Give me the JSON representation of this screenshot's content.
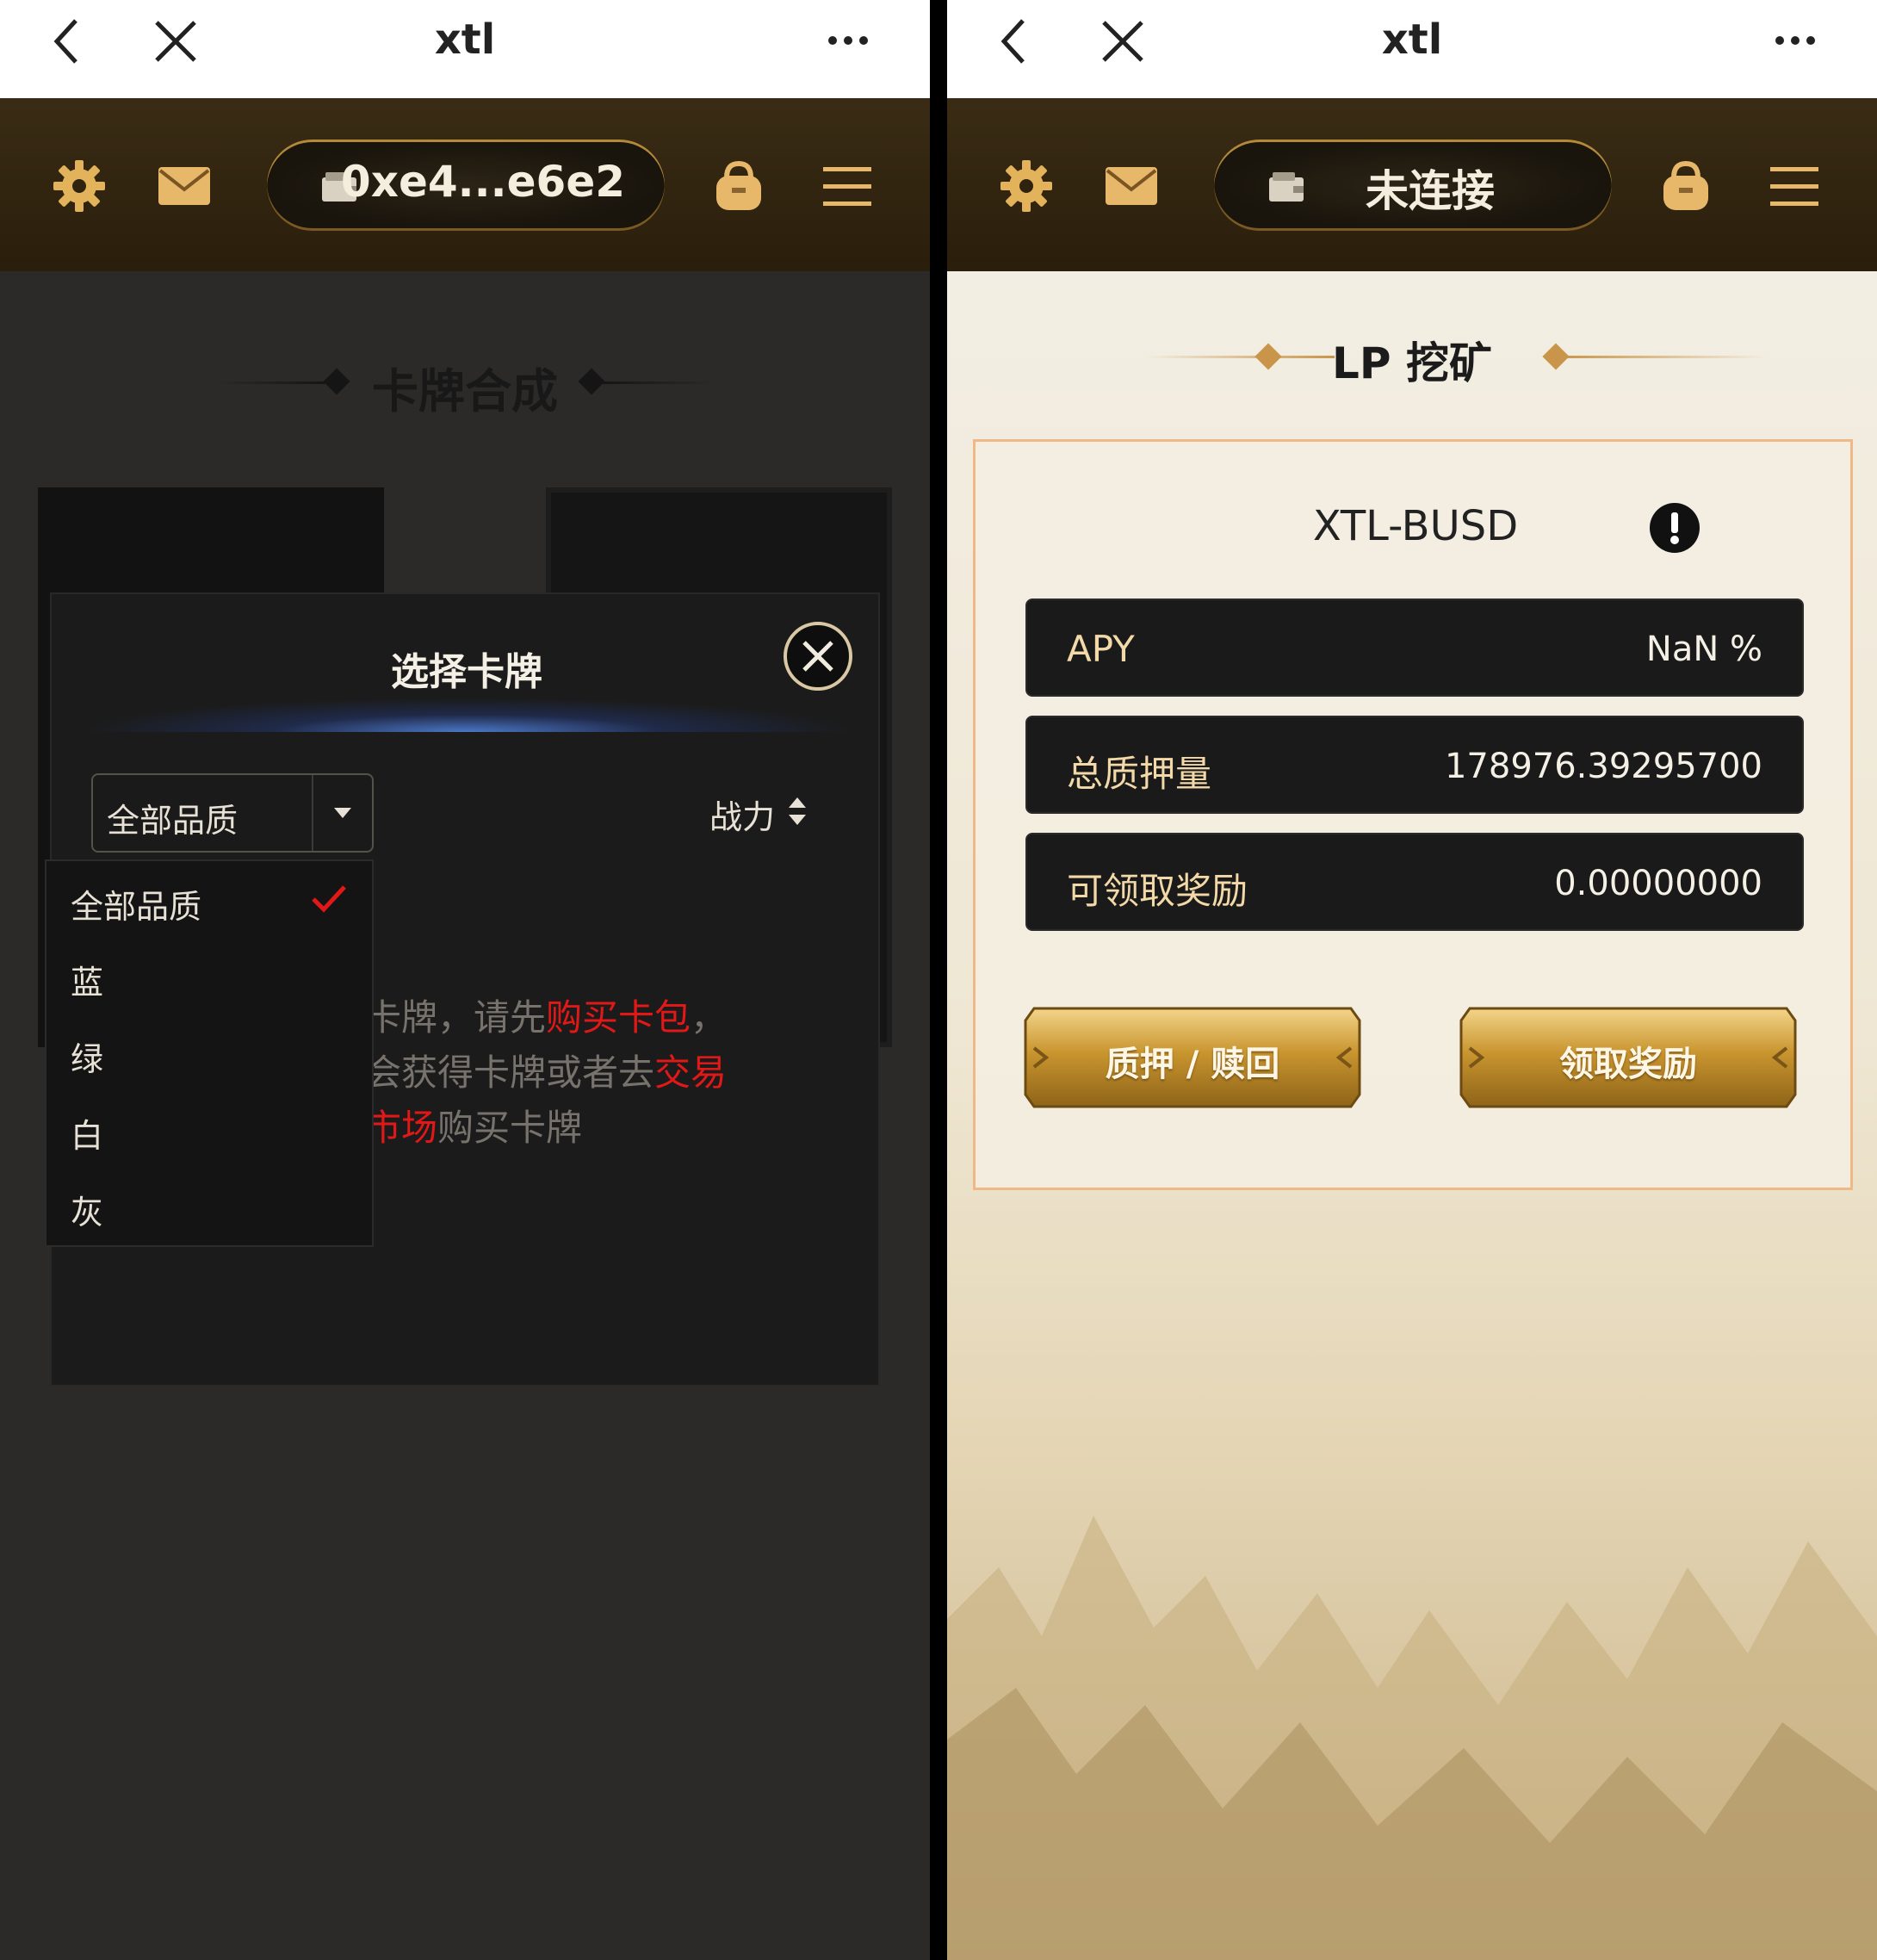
{
  "left": {
    "titlebar": {
      "title": "xtl"
    },
    "header": {
      "wallet_label": "0xe4...e6e2"
    },
    "section_title": "卡牌合成",
    "modal": {
      "title": "选择卡牌",
      "filter": {
        "selected": "全部品质",
        "options": [
          "全部品质",
          "蓝",
          "绿",
          "白",
          "灰"
        ]
      },
      "sort_label": "战力",
      "empty_message": {
        "part1": "您还没有卡牌，请先",
        "link1": "购买卡包",
        "part2": "，开启卡包会获得卡牌或者去",
        "link2": "交易市场",
        "part3": "购买卡牌"
      }
    }
  },
  "right": {
    "titlebar": {
      "title": "xtl"
    },
    "header": {
      "wallet_label": "未连接"
    },
    "section_title": "LP 挖矿",
    "pool": {
      "pair": "XTL-BUSD",
      "stats": [
        {
          "label": "APY",
          "value": "NaN %"
        },
        {
          "label": "总质押量",
          "value": "178976.39295700"
        },
        {
          "label": "可领取奖励",
          "value": "0.00000000"
        }
      ],
      "buttons": {
        "stake": "质押 / 赎回",
        "claim": "领取奖励"
      }
    }
  },
  "colors": {
    "accent_gold": "#c9952f",
    "link_red": "#e01818",
    "header_brown": "#2f230f"
  }
}
